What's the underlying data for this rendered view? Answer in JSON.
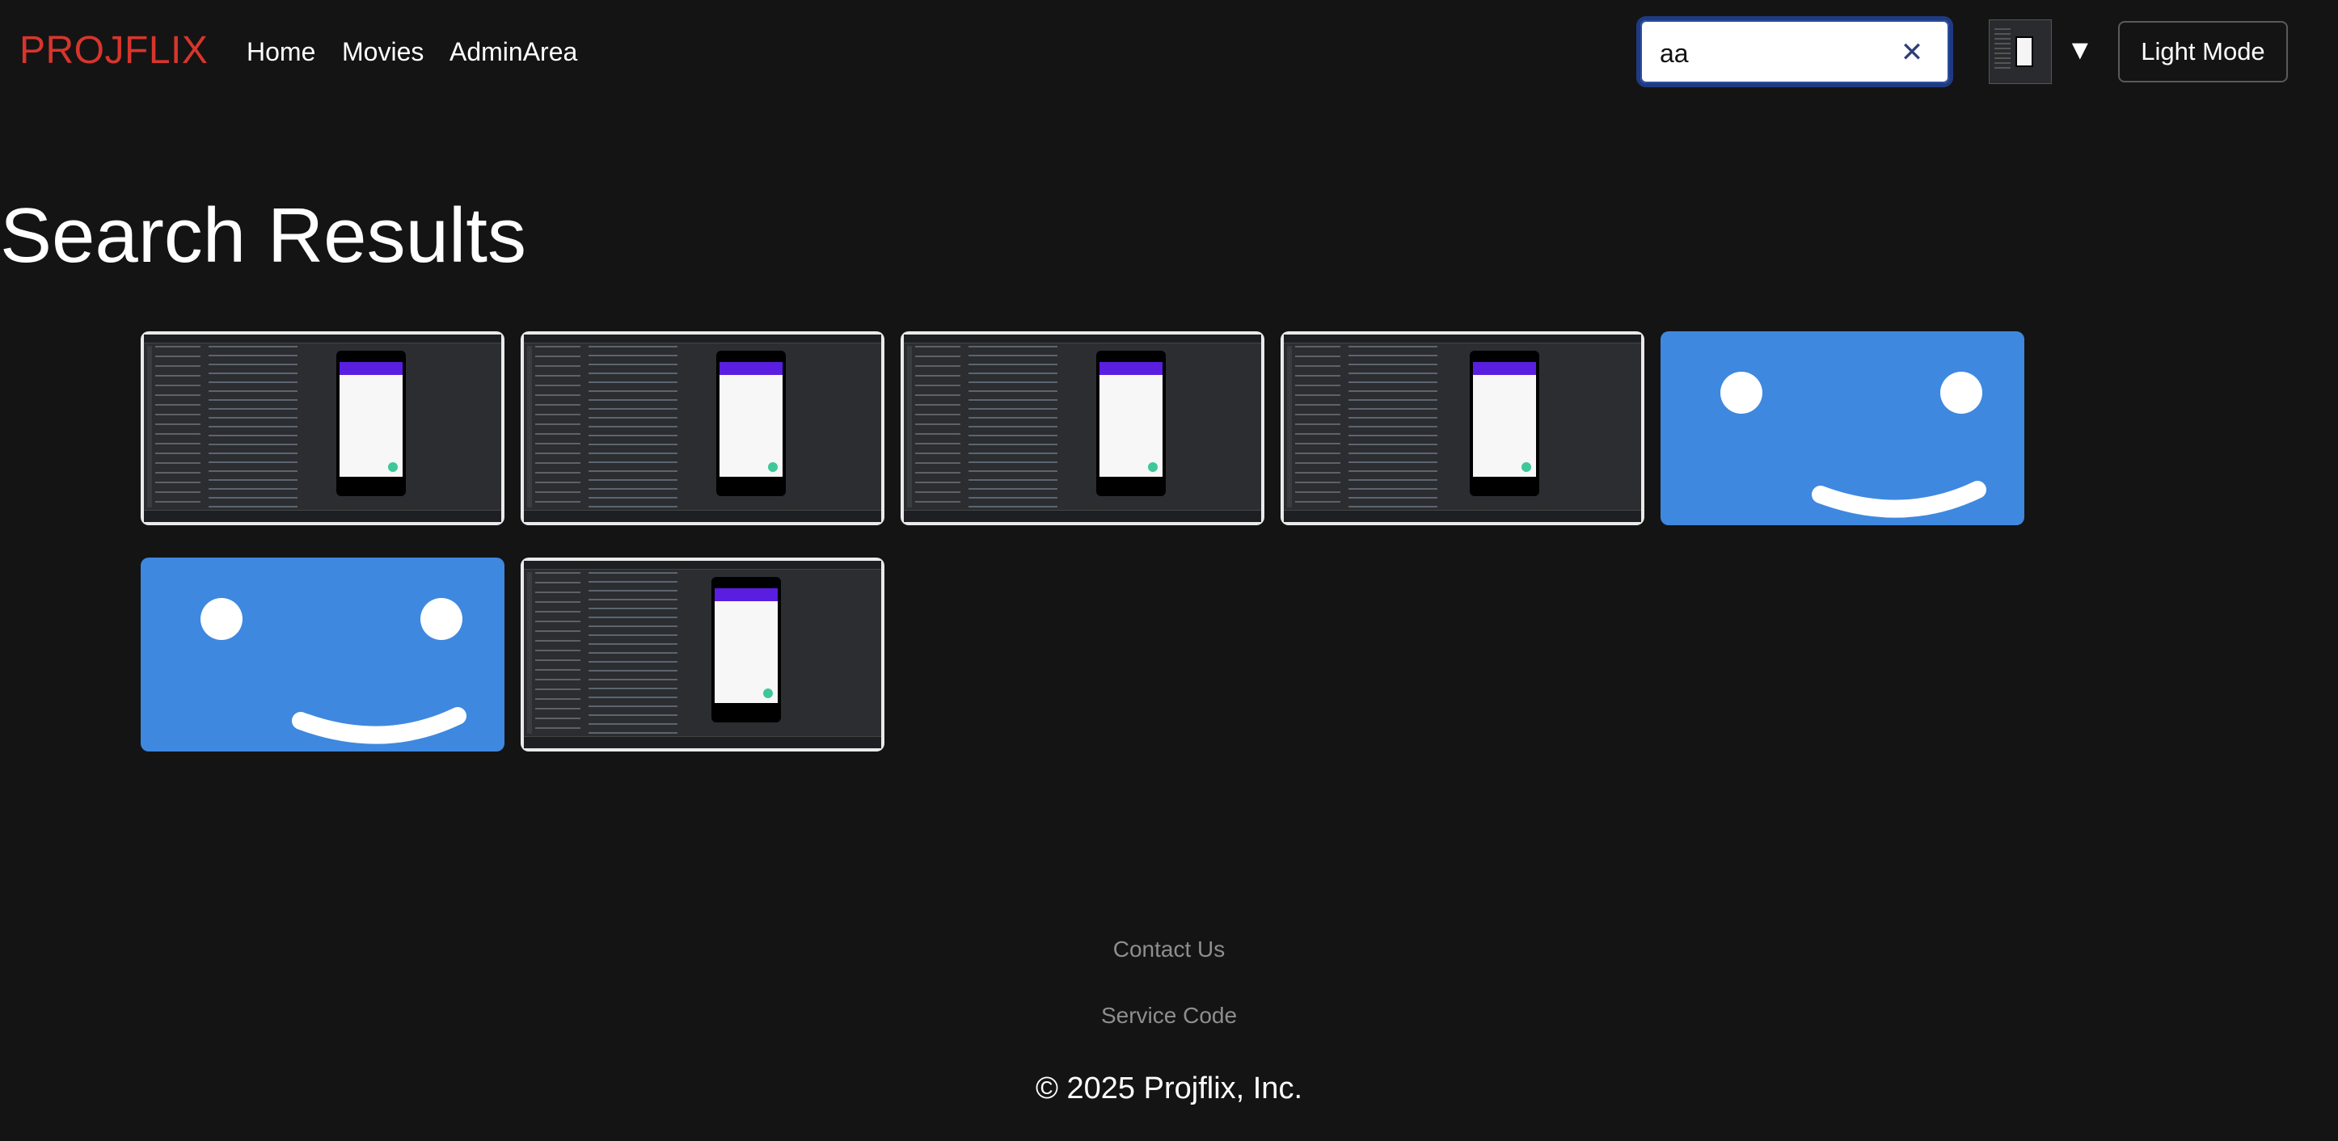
{
  "header": {
    "brand": "PROJFLIX",
    "nav": [
      "Home",
      "Movies",
      "AdminArea"
    ],
    "search": {
      "value": "aa",
      "clear_icon": "close-icon"
    },
    "mode_button": "Light Mode",
    "dropdown_icon": "caret-down-icon"
  },
  "main": {
    "title": "Search Results",
    "results": [
      {
        "type": "screenshot",
        "icon": "ide-screenshot-thumbnail"
      },
      {
        "type": "screenshot",
        "icon": "ide-screenshot-thumbnail"
      },
      {
        "type": "screenshot",
        "icon": "ide-screenshot-thumbnail"
      },
      {
        "type": "screenshot",
        "icon": "ide-screenshot-thumbnail"
      },
      {
        "type": "placeholder",
        "icon": "smiley-placeholder-icon"
      },
      {
        "type": "placeholder",
        "icon": "smiley-placeholder-icon"
      },
      {
        "type": "screenshot",
        "icon": "ide-screenshot-thumbnail"
      }
    ]
  },
  "footer": {
    "contact": "Contact Us",
    "service_code": "Service Code",
    "copyright": "© 2025 Projflix, Inc."
  },
  "colors": {
    "background": "#141414",
    "brand": "#d8352c",
    "placeholder_blue": "#3e88e0",
    "footer_link": "#8e8e8e"
  }
}
